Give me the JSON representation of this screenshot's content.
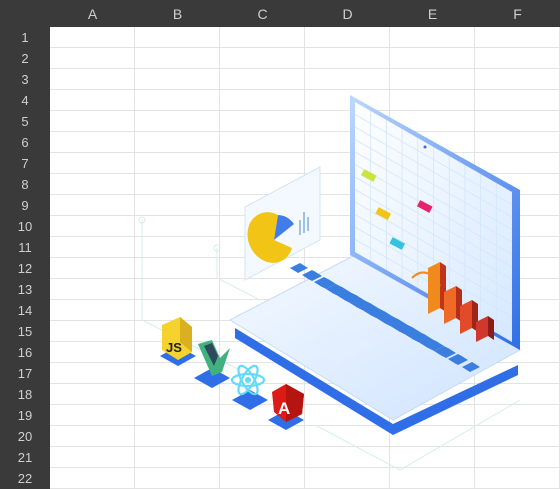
{
  "spreadsheet": {
    "columns": [
      "A",
      "B",
      "C",
      "D",
      "E",
      "F"
    ],
    "rows": [
      "1",
      "2",
      "3",
      "4",
      "5",
      "6",
      "7",
      "8",
      "9",
      "10",
      "11",
      "12",
      "13",
      "14",
      "15",
      "16",
      "17",
      "18",
      "19",
      "20",
      "21",
      "22"
    ]
  },
  "illustration": {
    "badges": {
      "js": "JS",
      "angular": "A"
    },
    "icons": [
      "javascript-logo",
      "vue-logo",
      "react-logo",
      "angular-logo",
      "laptop-illustration",
      "pie-chart-card",
      "bar-chart-3d"
    ],
    "colors": {
      "header_bg": "#3a3a3a",
      "header_text": "#cfcfcf",
      "laptop_blue": "#2f6ee6",
      "screen_light": "#e9f3ff",
      "js_yellow": "#f5d22e",
      "vue_green": "#3fb27f",
      "vue_dark": "#2f4a5c",
      "react_cyan": "#61dafb",
      "angular_red": "#dd1b16"
    }
  }
}
